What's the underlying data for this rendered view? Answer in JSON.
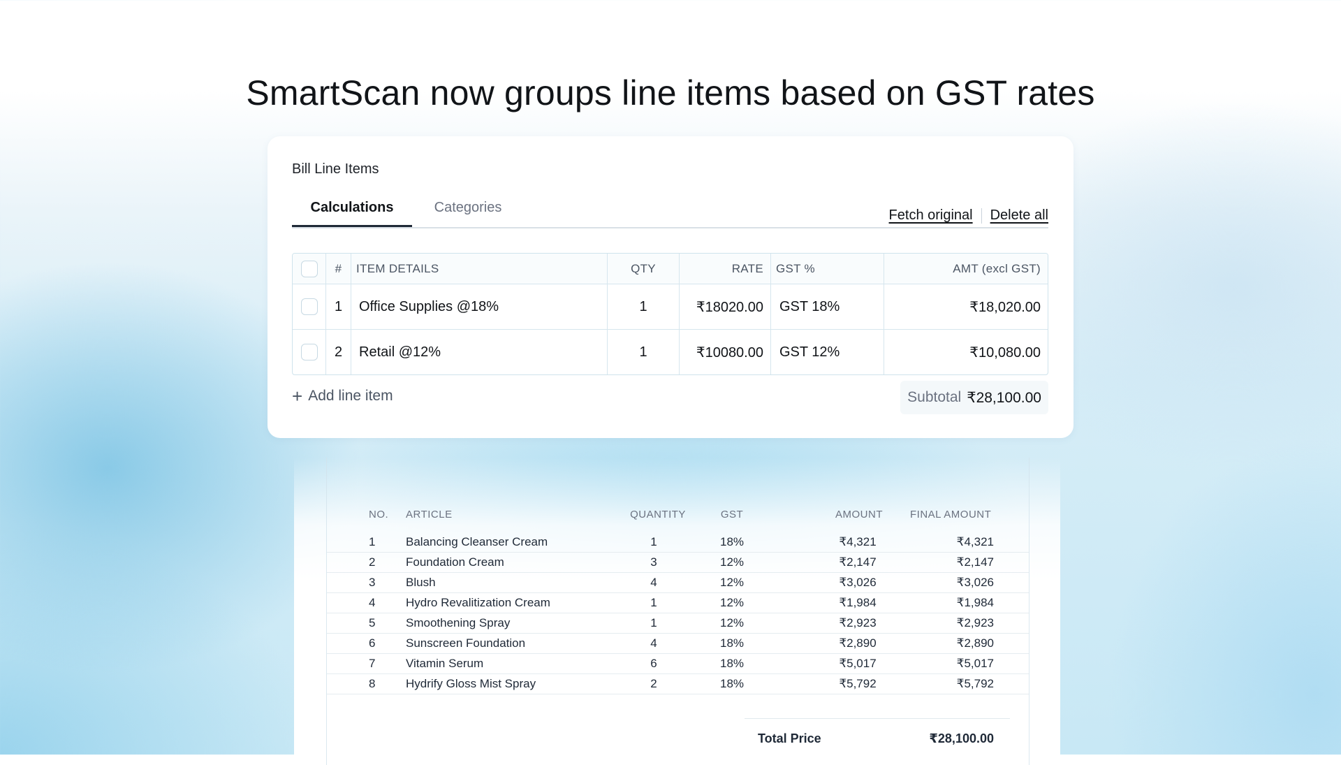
{
  "headline": "SmartScan now groups line items based on GST rates",
  "card": {
    "title": "Bill Line Items",
    "tabs": [
      {
        "label": "Calculations",
        "active": true
      },
      {
        "label": "Categories",
        "active": false
      }
    ],
    "actions": {
      "fetch_original": "Fetch original",
      "delete_all": "Delete all"
    },
    "table": {
      "headers": {
        "num": "#",
        "item": "ITEM DETAILS",
        "qty": "QTY",
        "rate": "RATE",
        "gst": "GST %",
        "amount": "AMT (excl GST)"
      },
      "rows": [
        {
          "num": "1",
          "item": "Office Supplies @18%",
          "qty": "1",
          "rate": "₹18020.00",
          "gst": "GST 18%",
          "amount": "₹18,020.00"
        },
        {
          "num": "2",
          "item": "Retail @12%",
          "qty": "1",
          "rate": "₹10080.00",
          "gst": "GST 12%",
          "amount": "₹10,080.00"
        }
      ]
    },
    "add_line_item": "Add line item",
    "subtotal_label": "Subtotal",
    "subtotal_value": "₹28,100.00"
  },
  "receipt": {
    "headers": {
      "no": "NO.",
      "article": "ARTICLE",
      "quantity": "QUANTITY",
      "gst": "GST",
      "amount": "AMOUNT",
      "final_amount": "FINAL AMOUNT"
    },
    "rows": [
      {
        "no": "1",
        "article": "Balancing Cleanser Cream",
        "quantity": "1",
        "gst": "18%",
        "amount": "₹4,321",
        "final_amount": "₹4,321"
      },
      {
        "no": "2",
        "article": "Foundation Cream",
        "quantity": "3",
        "gst": "12%",
        "amount": "₹2,147",
        "final_amount": "₹2,147"
      },
      {
        "no": "3",
        "article": "Blush",
        "quantity": "4",
        "gst": "12%",
        "amount": "₹3,026",
        "final_amount": "₹3,026"
      },
      {
        "no": "4",
        "article": "Hydro Revalitization Cream",
        "quantity": "1",
        "gst": "12%",
        "amount": "₹1,984",
        "final_amount": "₹1,984"
      },
      {
        "no": "5",
        "article": "Smoothening Spray",
        "quantity": "1",
        "gst": "12%",
        "amount": "₹2,923",
        "final_amount": "₹2,923"
      },
      {
        "no": "6",
        "article": "Sunscreen Foundation",
        "quantity": "4",
        "gst": "18%",
        "amount": "₹2,890",
        "final_amount": "₹2,890"
      },
      {
        "no": "7",
        "article": "Vitamin Serum",
        "quantity": "6",
        "gst": "18%",
        "amount": "₹5,017",
        "final_amount": "₹5,017"
      },
      {
        "no": "8",
        "article": "Hydrify Gloss Mist Spray",
        "quantity": "2",
        "gst": "18%",
        "amount": "₹5,792",
        "final_amount": "₹5,792"
      }
    ],
    "total_label": "Total Price",
    "total_value": "₹28,100.00"
  }
}
